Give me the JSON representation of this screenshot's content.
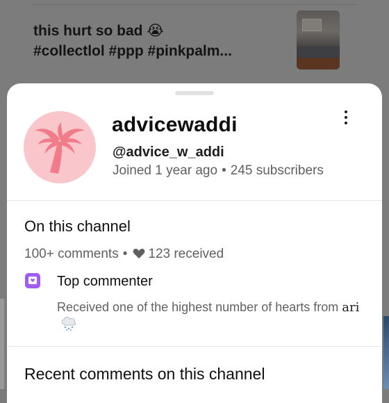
{
  "background_comment": {
    "text_line1": "this hurt so bad 😭",
    "text_line2": "#collectlol #ppp #pinkpalm...",
    "thumbnail_icon": "room-photo-thumbnail"
  },
  "channel": {
    "name": "advicewaddi",
    "handle": "@advice_w_addi",
    "joined": "Joined 1 year ago",
    "separator": "•",
    "subscribers": "245 subscribers",
    "avatar_icon": "palm-tree-icon",
    "avatar_color": "#f9c6cc",
    "avatar_icon_color": "#f27b8a"
  },
  "menu": {
    "icon": "more-vert-icon"
  },
  "on_this_channel": {
    "title": "On this channel",
    "comments": "100+ comments",
    "separator": "•",
    "hearts": "123 received",
    "heart_icon": "heart-icon"
  },
  "badge": {
    "icon": "top-commenter-icon",
    "icon_color": "#a25cf4",
    "title": "Top commenter",
    "description": "Received one of the highest number of hearts from",
    "from_name": "ari",
    "from_icon": "snow-cloud-icon"
  },
  "recent": {
    "title": "Recent comments on this channel"
  }
}
